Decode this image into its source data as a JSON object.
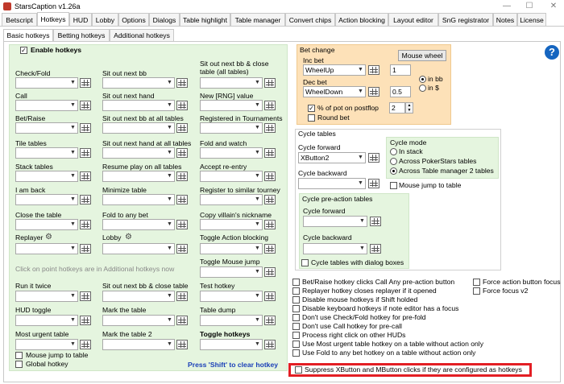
{
  "window": {
    "title": "StarsCaption v1.26a",
    "min": "—",
    "max": "☐",
    "close": "✕"
  },
  "main_tabs": [
    "Betscript",
    "Hotkeys",
    "HUD",
    "Lobby",
    "Options",
    "Dialogs",
    "Table highlight",
    "Table manager",
    "Convert chips",
    "Action blocking",
    "Layout editor",
    "SnG registrator",
    "Notes",
    "License"
  ],
  "sub_tabs": [
    "Basic hotkeys",
    "Betting hotkeys",
    "Additional hotkeys"
  ],
  "enable_hotkeys": "Enable hotkeys",
  "col1": [
    "Check/Fold",
    "Call",
    "Bet/Raise",
    "Tile tables",
    "Stack tables",
    "I am back",
    "Close the table",
    "Replayer"
  ],
  "col2": [
    "Sit out next bb",
    "Sit out next hand",
    "Sit out next bb at all tables",
    "Sit out next hand at all tables",
    "Resume play on all tables",
    "Minimize table",
    "Fold to any bet",
    "Lobby"
  ],
  "col3": [
    "Sit out next bb & close table (all tables)",
    "New [RNG] value",
    "Registered in Tournaments",
    "Fold and watch",
    "Accept re-entry",
    "Register to similar tourney",
    "Copy villain's nickname",
    "Toggle Action blocking",
    "Toggle Mouse jump"
  ],
  "click_note": "Click on point hotkeys are in Additional hotkeys now",
  "col1b": [
    "Run it twice",
    "HUD toggle",
    "Most urgent table"
  ],
  "col2b": [
    "Sit out next bb & close table",
    "Mark the table",
    "Mark the table 2"
  ],
  "col3b": [
    "Test hotkey",
    "Table dump",
    "Toggle hotkeys"
  ],
  "mouse_jump_to_table": "Mouse jump to table",
  "global_hotkey": "Global hotkey",
  "shift_note": "Press 'Shift' to clear hotkey",
  "bet_change": {
    "title": "Bet change",
    "mouse_wheel": "Mouse wheel",
    "inc_label": "Inc bet",
    "inc_value": "WheelUp",
    "inc_num": "1",
    "dec_label": "Dec bet",
    "dec_value": "WheelDown",
    "dec_num": "0.5",
    "in_bb": "in bb",
    "in_dollar": "in $",
    "pct_label": "% of pot on postflop",
    "pct_num": "2",
    "round_bet": "Round bet"
  },
  "cycle": {
    "title": "Cycle tables",
    "fwd_label": "Cycle forward",
    "fwd_value": "XButton2",
    "bwd_label": "Cycle backward",
    "mode_title": "Cycle mode",
    "modes": [
      "In stack",
      "Across PokerStars tables",
      "Across Table manager 2 tables"
    ],
    "mouse_jump": "Mouse jump to table",
    "pre_title": "Cycle pre-action tables",
    "pre_fwd": "Cycle forward",
    "pre_bwd": "Cycle backward",
    "with_dialog": "Cycle tables with dialog boxes"
  },
  "options": [
    "Bet/Raise hotkey clicks Call Any pre-action button",
    "Replayer hotkey closes replayer if it opened",
    "Disable mouse hotkeys if Shift holded",
    "Disable keyboard hotkeys if note editor has a focus",
    "Don't use Check/Fold hotkey for pre-fold",
    "Don't use Call hotkey for pre-call",
    "Process right click on other HUDs",
    "Use Most urgent table hotkey on a table without action only",
    "Use Fold to any bet hotkey on a table without action only",
    "Suppress XButton and MButton clicks if they are configured as hotkeys"
  ],
  "options_right": [
    "Force action button focus",
    "Force focus v2"
  ],
  "colors": {
    "green_box": "#e5f5df",
    "orange_box": "#fde1b8",
    "highlight": "#e31e24",
    "help": "#1565c0"
  }
}
